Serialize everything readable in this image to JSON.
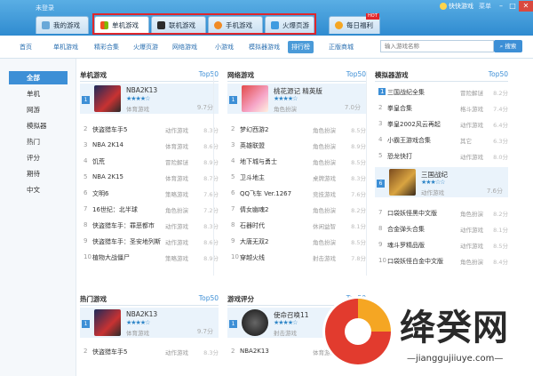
{
  "titlebar": {
    "login": "未登录",
    "brand": "快快游戏",
    "menu": "菜单"
  },
  "tabs": [
    {
      "label": "我的游戏"
    },
    {
      "label": "单机游戏"
    },
    {
      "label": "联机游戏"
    },
    {
      "label": "手机游戏"
    },
    {
      "label": "火爆页游"
    },
    {
      "label": "每日福利",
      "badge": "HOT"
    }
  ],
  "subnav": [
    "首页",
    "单机游戏",
    "精彩合集",
    "火爆页游",
    "网络游戏",
    "小游戏",
    "模拟器游戏",
    "排行榜",
    "正版商城"
  ],
  "search": {
    "placeholder": "输入游戏名称",
    "button": "搜索"
  },
  "categories": [
    "全部",
    "单机",
    "网游",
    "模拟器",
    "热门",
    "评分",
    "期待",
    "中文"
  ],
  "panels": {
    "single": {
      "title": "单机游戏",
      "more": "Top50",
      "featured": {
        "rank": "1",
        "name": "NBA2K13",
        "genre": "体育游戏",
        "score": "9.7分"
      },
      "rows": [
        {
          "rank": "2",
          "name": "侠盗猎车手5",
          "genre": "动作游戏",
          "score": "8.3分"
        },
        {
          "rank": "3",
          "name": "NBA 2K14",
          "genre": "体育游戏",
          "score": "8.6分"
        },
        {
          "rank": "4",
          "name": "饥荒",
          "genre": "冒险解谜",
          "score": "8.9分"
        },
        {
          "rank": "5",
          "name": "NBA 2K15",
          "genre": "体育游戏",
          "score": "8.7分"
        },
        {
          "rank": "6",
          "name": "文明6",
          "genre": "策略游戏",
          "score": "7.6分"
        },
        {
          "rank": "7",
          "name": "16世纪：北半球",
          "genre": "角色扮演",
          "score": "7.2分"
        },
        {
          "rank": "8",
          "name": "侠盗猎车手：罪恶都市",
          "genre": "动作游戏",
          "score": "8.3分"
        },
        {
          "rank": "9",
          "name": "侠盗猎车手：圣安地列斯",
          "genre": "动作游戏",
          "score": "8.6分"
        },
        {
          "rank": "10",
          "name": "植物大战僵尸",
          "genre": "策略游戏",
          "score": "8.9分"
        }
      ]
    },
    "online": {
      "title": "网络游戏",
      "more": "Top50",
      "featured": {
        "rank": "1",
        "name": "桃花源记 精英版",
        "genre": "角色扮演",
        "score": "7.0分"
      },
      "rows": [
        {
          "rank": "2",
          "name": "梦幻西游2",
          "genre": "角色扮演",
          "score": "8.5分"
        },
        {
          "rank": "3",
          "name": "英雄联盟",
          "genre": "角色扮演",
          "score": "8.9分"
        },
        {
          "rank": "4",
          "name": "地下城与勇士",
          "genre": "角色扮演",
          "score": "8.5分"
        },
        {
          "rank": "5",
          "name": "卫斗地主",
          "genre": "桌牌游戏",
          "score": "8.3分"
        },
        {
          "rank": "6",
          "name": "QQ飞车 Ver.1267",
          "genre": "竞技游戏",
          "score": "7.6分"
        },
        {
          "rank": "7",
          "name": "倩女幽魂2",
          "genre": "角色扮演",
          "score": "8.2分"
        },
        {
          "rank": "8",
          "name": "石器时代",
          "genre": "休闲益智",
          "score": "8.1分"
        },
        {
          "rank": "9",
          "name": "大唐无双2",
          "genre": "角色扮演",
          "score": "8.5分"
        },
        {
          "rank": "10",
          "name": "穿越火线",
          "genre": "射击游戏",
          "score": "7.8分"
        }
      ]
    },
    "emulator": {
      "title": "模拟器游戏",
      "more": "Top50",
      "rows_top": [
        {
          "rank": "1",
          "name": "三国战纪全集",
          "genre": "冒险解谜",
          "score": "8.2分"
        },
        {
          "rank": "2",
          "name": "拳皇合集",
          "genre": "格斗游戏",
          "score": "7.4分"
        },
        {
          "rank": "3",
          "name": "拳皇2002风云再起",
          "genre": "动作游戏",
          "score": "6.4分"
        },
        {
          "rank": "4",
          "name": "小霸王游戏合集",
          "genre": "其它",
          "score": "6.3分"
        },
        {
          "rank": "5",
          "name": "恐龙快打",
          "genre": "动作游戏",
          "score": "8.0分"
        }
      ],
      "featured": {
        "rank": "6",
        "name": "三国战纪",
        "genre": "动作游戏",
        "score": "7.6分"
      },
      "rows_bottom": [
        {
          "rank": "7",
          "name": "口袋妖怪黑中文版",
          "genre": "角色扮演",
          "score": "8.2分"
        },
        {
          "rank": "8",
          "name": "合金弹头合集",
          "genre": "动作游戏",
          "score": "8.1分"
        },
        {
          "rank": "9",
          "name": "魂斗罗精品版",
          "genre": "动作游戏",
          "score": "8.5分"
        },
        {
          "rank": "10",
          "name": "口袋妖怪白金中文版",
          "genre": "角色扮演",
          "score": "8.4分"
        }
      ]
    },
    "hot": {
      "title": "热门游戏",
      "more": "Top50",
      "featured": {
        "rank": "1",
        "name": "NBA2K13",
        "genre": "体育游戏",
        "score": "9.7分"
      },
      "rows": [
        {
          "rank": "2",
          "name": "侠盗猎车手5",
          "genre": "动作游戏",
          "score": "8.3分"
        }
      ]
    },
    "rating": {
      "title": "游戏评分",
      "more": "Top50",
      "featured": {
        "rank": "1",
        "name": "使命召唤11",
        "genre": "射击游戏",
        "score": ""
      },
      "rows": [
        {
          "rank": "2",
          "name": "NBA2K13",
          "genre": "体育游戏",
          "score": ""
        }
      ]
    }
  },
  "watermark": {
    "logo_text": "绛癸网",
    "url": "—jianggujiiuye.com—"
  },
  "colors": {
    "accent": "#3d8fd6",
    "titlebar": "#3a95d8",
    "highlight": "#e0262b"
  }
}
